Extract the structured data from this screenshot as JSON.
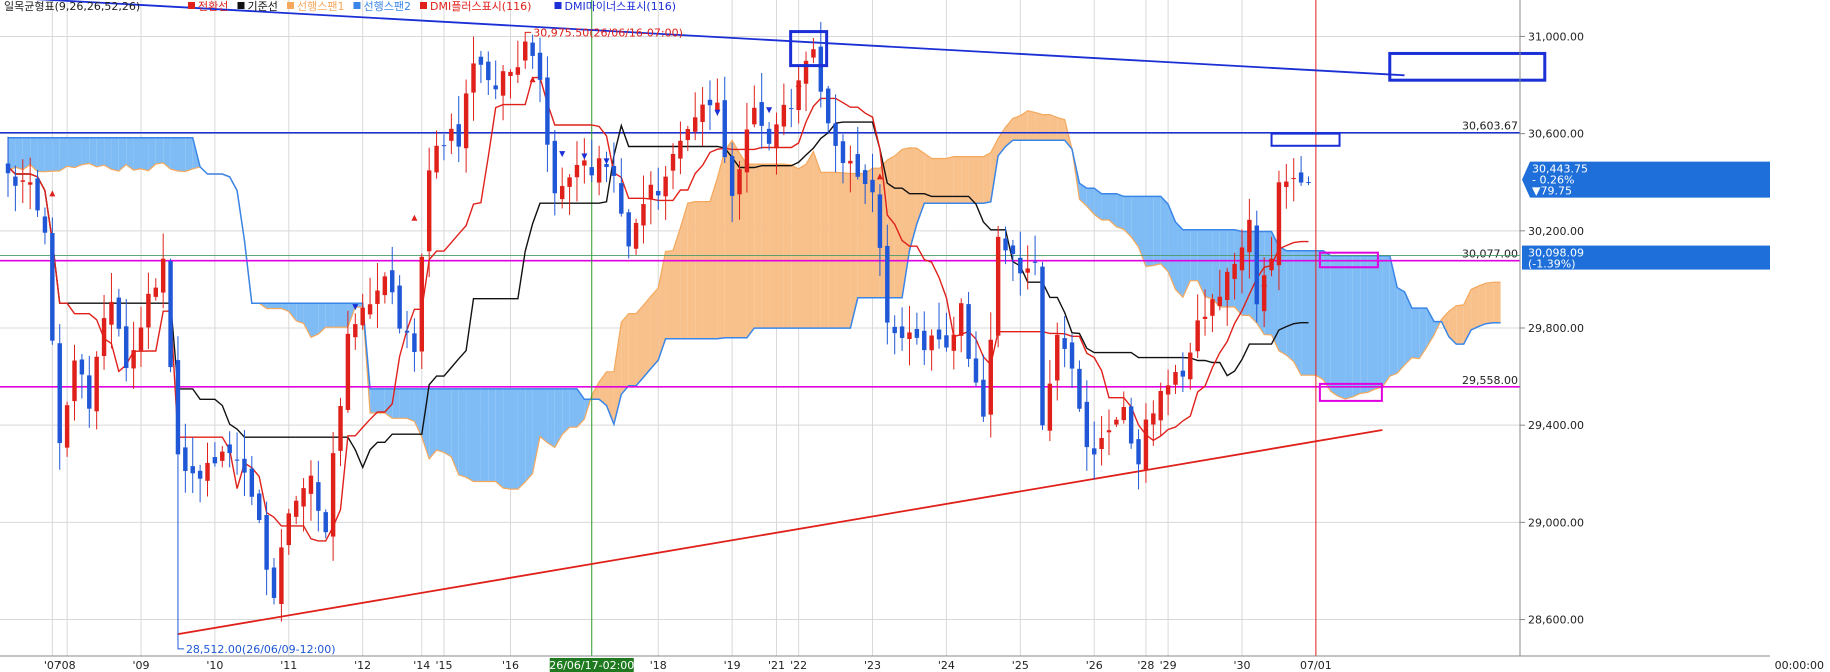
{
  "chart_data": {
    "type": "candlestick",
    "legend": [
      {
        "label": "일목균형표(9,26,26,52,26)",
        "color": "#222222"
      },
      {
        "label": "전환선",
        "color": "#e0201a"
      },
      {
        "label": "기준선",
        "color": "#111111"
      },
      {
        "label": "선행스팬1",
        "color": "#f4a85c"
      },
      {
        "label": "선행스팬2",
        "color": "#3a86e8"
      },
      {
        "label": "DMI플러스표시(116)",
        "color": "#e0201a"
      },
      {
        "label": "DMI마이너스표시(116)",
        "color": "#1a2fd6"
      }
    ],
    "colors": {
      "up": "#e0201a",
      "down": "#1f57d6",
      "conversion": "#e0201a",
      "base": "#111111",
      "cloud_bull": "#f8c08b",
      "cloud_bear": "#7fbcf5",
      "span1": "#f4a85c",
      "span2": "#3a86e8",
      "horizontal_blue": "#1a2fd6",
      "horizontal_magenta": "#e000e0",
      "trend_red": "#e0201a",
      "trend_blue": "#1a2fd6"
    },
    "ylim": [
      28450,
      31150
    ],
    "y_ticks": [
      "31,000.00",
      "30,600.00",
      "30,200.00",
      "29,800.00",
      "29,400.00",
      "29,000.00",
      "28,600.00"
    ],
    "y_tick_values": [
      31000,
      30600,
      30200,
      29800,
      29400,
      29000,
      28600
    ],
    "x_ticks": [
      "07",
      "08",
      "09",
      "10",
      "11",
      "12",
      "14",
      "15",
      "16",
      "18",
      "19",
      "21",
      "22",
      "23",
      "24",
      "25",
      "26",
      "28",
      "29",
      "30"
    ],
    "x_tick_index": [
      6,
      8,
      18,
      28,
      38,
      48,
      56,
      59,
      68,
      88,
      98,
      104,
      107,
      117,
      127,
      137,
      147,
      154,
      157,
      167
    ],
    "x_end_tick": "07/01",
    "time_label": "00:00:00",
    "cursor_time": "26/06/17-02:00",
    "cursor_index": 79,
    "data_count": 177,
    "future_count": 26,
    "waypoints": [
      [
        0,
        30420
      ],
      [
        3,
        30380
      ],
      [
        5,
        30150
      ],
      [
        7,
        29300
      ],
      [
        9,
        29700
      ],
      [
        11,
        29500
      ],
      [
        14,
        29950
      ],
      [
        16,
        29650
      ],
      [
        19,
        29900
      ],
      [
        21,
        30050
      ],
      [
        23,
        29300
      ],
      [
        25,
        29150
      ],
      [
        28,
        29250
      ],
      [
        31,
        29250
      ],
      [
        34,
        29000
      ],
      [
        36,
        28700
      ],
      [
        38,
        29050
      ],
      [
        41,
        29200
      ],
      [
        43,
        29000
      ],
      [
        46,
        29800
      ],
      [
        48,
        29850
      ],
      [
        51,
        30000
      ],
      [
        55,
        29700
      ],
      [
        57,
        30450
      ],
      [
        59,
        30550
      ],
      [
        61,
        30600
      ],
      [
        63,
        30900
      ],
      [
        66,
        30750
      ],
      [
        70,
        30960
      ],
      [
        72,
        30800
      ],
      [
        74,
        30400
      ],
      [
        78,
        30450
      ],
      [
        82,
        30480
      ],
      [
        84,
        30100
      ],
      [
        86,
        30300
      ],
      [
        88,
        30400
      ],
      [
        90,
        30500
      ],
      [
        93,
        30650
      ],
      [
        96,
        30720
      ],
      [
        98,
        30350
      ],
      [
        101,
        30720
      ],
      [
        103,
        30600
      ],
      [
        106,
        30700
      ],
      [
        109,
        30950
      ],
      [
        111,
        30600
      ],
      [
        114,
        30500
      ],
      [
        117,
        30400
      ],
      [
        119,
        29800
      ],
      [
        123,
        29780
      ],
      [
        126,
        29700
      ],
      [
        129,
        29850
      ],
      [
        132,
        29400
      ],
      [
        134,
        30150
      ],
      [
        137,
        30050
      ],
      [
        139,
        30120
      ],
      [
        140,
        29400
      ],
      [
        142,
        29750
      ],
      [
        144,
        29650
      ],
      [
        146,
        29300
      ],
      [
        148,
        29300
      ],
      [
        151,
        29500
      ],
      [
        153,
        29250
      ],
      [
        155,
        29500
      ],
      [
        157,
        29600
      ],
      [
        159,
        29550
      ],
      [
        161,
        29800
      ],
      [
        164,
        29950
      ],
      [
        166,
        30050
      ],
      [
        168,
        30200
      ],
      [
        169,
        29950
      ],
      [
        171,
        30050
      ],
      [
        172,
        30350
      ],
      [
        174,
        30450
      ],
      [
        176,
        30430
      ]
    ],
    "highlight_levels": [
      {
        "label": "30,603.67",
        "value": 30603.67,
        "color": "#1a2fd6"
      },
      {
        "label": "30,077.00",
        "value": 30077,
        "color": "#e000e0"
      },
      {
        "label": "29,558.00",
        "value": 29558,
        "color": "#e000e0"
      }
    ],
    "current_price": {
      "value": 30443.75,
      "label": "30,443.75",
      "change": "- 0.26%",
      "delta": "▼79.75"
    },
    "level_box": {
      "value": 30098.09,
      "label": "30,098.09",
      "change": "(-1.39%)"
    },
    "annotations": [
      {
        "text": "30,975.50(26/06/16-07:00)",
        "index": 70,
        "value": 30975.5,
        "color": "#e0201a"
      },
      {
        "text": "28,512.00(26/06/09-12:00)",
        "index": 23,
        "value": 28512,
        "color": "#1f57d6"
      }
    ],
    "trendlines": [
      {
        "name": "red-support",
        "from": {
          "index": 23,
          "value": 28540
        },
        "to": {
          "index": 186,
          "value": 29380
        },
        "color": "#e0201a"
      },
      {
        "name": "blue-resistance",
        "from": {
          "index": 0,
          "value": 31160
        },
        "to": {
          "index": 189,
          "value": 30840
        },
        "color": "#1a2fd6"
      }
    ],
    "dmi_plus_marks": [
      [
        6,
        30350
      ],
      [
        55,
        30250
      ],
      [
        71,
        30820
      ],
      [
        107,
        30800
      ],
      [
        118,
        30420
      ],
      [
        170,
        29980
      ]
    ],
    "dmi_minus_marks": [
      [
        47,
        29890
      ],
      [
        75,
        30520
      ],
      [
        78,
        30510
      ],
      [
        81,
        30490
      ],
      [
        96,
        30690
      ],
      [
        103,
        30700
      ]
    ],
    "grid": true
  }
}
